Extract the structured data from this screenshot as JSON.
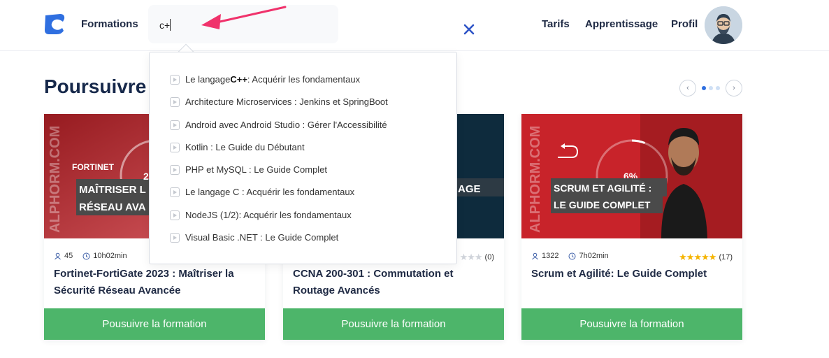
{
  "header": {
    "nav_formations": "Formations",
    "search_value": "c+",
    "nav_tarifs": "Tarifs",
    "nav_apprentissage": "Apprentissage",
    "nav_profil": "Profil"
  },
  "section": {
    "title_visible": "Poursuivre n"
  },
  "suggestions": [
    {
      "bold": "",
      "pre": "Le langage ",
      "hl": "C++",
      "post": " : Acquérir les fondamentaux"
    },
    {
      "pre": "Architecture Microservices : Jenkins et SpringBoot",
      "hl": "",
      "post": ""
    },
    {
      "pre": "Android avec Android Studio : Gérer l'Accessibilité",
      "hl": "",
      "post": ""
    },
    {
      "pre": "Kotlin : Le Guide du Débutant",
      "hl": "",
      "post": ""
    },
    {
      "pre": "PHP et MySQL : Le Guide Complet",
      "hl": "",
      "post": ""
    },
    {
      "pre": "Le langage C : Acquérir les fondamentaux",
      "hl": "",
      "post": ""
    },
    {
      "pre": "NodeJS (1/2): Acquérir les fondamentaux",
      "hl": "",
      "post": ""
    },
    {
      "pre": "Visual Basic .NET : Le Guide Complet",
      "hl": "",
      "post": ""
    }
  ],
  "cards": [
    {
      "students": "45",
      "duration": "10h02min",
      "title": "Fortinet-FortiGate 2023 : Maîtriser la Sécurité Réseau Avancée",
      "button": "Pousuivre la formation",
      "thumb_brand": "ALPHORM.COM",
      "thumb_vendor": "FORTINET",
      "thumb_line1": "MAÎTRISER L",
      "thumb_line2": "RÉSEAU AVA",
      "progress_label": "2"
    },
    {
      "rating_count": "(0)",
      "title": "CCNA 200-301 : Commutation et Routage Avancés",
      "button": "Pousuivre la formation",
      "thumb_line": "AGE"
    },
    {
      "students": "1322",
      "duration": "7h02min",
      "rating_count": "(17)",
      "title": "Scrum et Agilité: Le Guide Complet",
      "button": "Pousuivre la formation",
      "thumb_brand": "ALPHORM.COM",
      "thumb_line1": "SCRUM ET AGILITÉ :",
      "thumb_line2": "LE GUIDE COMPLET",
      "progress_label": "6%",
      "progress": 0.06
    }
  ],
  "colors": {
    "accent_blue": "#2f6fe0",
    "button_green": "#4db56a",
    "thumb_red": "#c8232a",
    "thumb_dark": "#0e2b3d",
    "annotation_pink": "#f0326b"
  }
}
